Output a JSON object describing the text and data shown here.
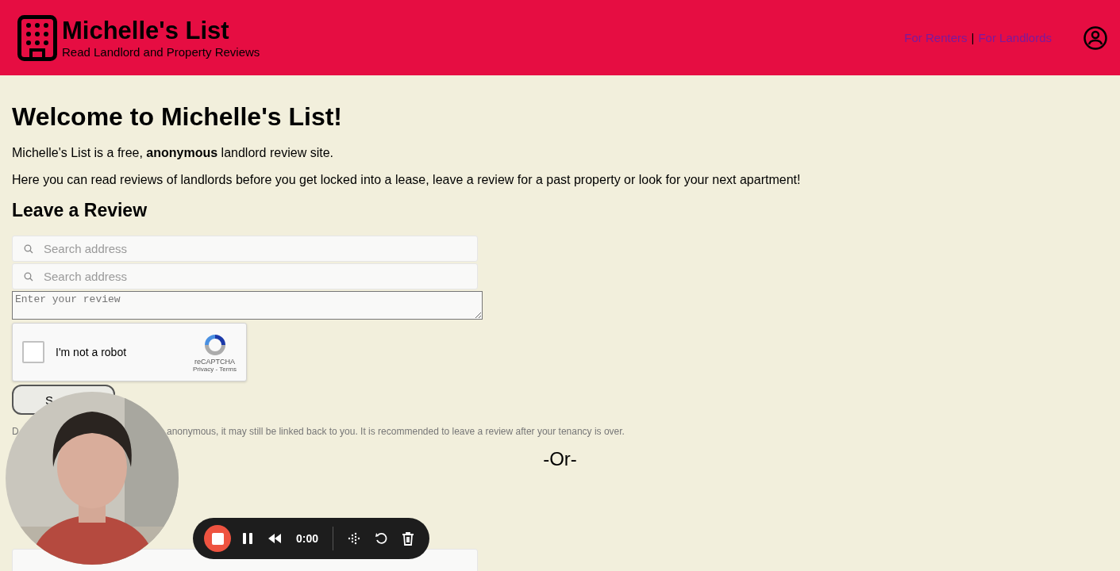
{
  "header": {
    "title": "Michelle's List",
    "subtitle": "Read Landlord and Property Reviews",
    "nav": [
      {
        "label": "For Renters"
      },
      {
        "label": "For Landlords"
      }
    ],
    "separator": "|"
  },
  "intro": {
    "heading": "Welcome to Michelle's List!",
    "lines": [
      "Michelle's List is a free, **anonymous** landlord review site.",
      "Here you can read reviews of landlords before you get locked into a lease, leave a review for a past property or look for your next apartment!"
    ]
  },
  "review_form": {
    "heading": "Leave a Review",
    "search_fields": [
      {
        "placeholder": "Search address"
      },
      {
        "placeholder": "Search address"
      }
    ],
    "review_placeholder": "Enter your review",
    "captcha": {
      "label": "I'm not a robot",
      "checked": false,
      "brand": "reCAPTCHA",
      "links": "Privacy - Terms"
    },
    "submit": "S",
    "note_start": "D",
    "note": "anonymous, it may still be linked back to you. It is recommended to leave a review after your tenancy is over."
  },
  "divider": "-Or-",
  "recorder": {
    "time": "0:00"
  }
}
